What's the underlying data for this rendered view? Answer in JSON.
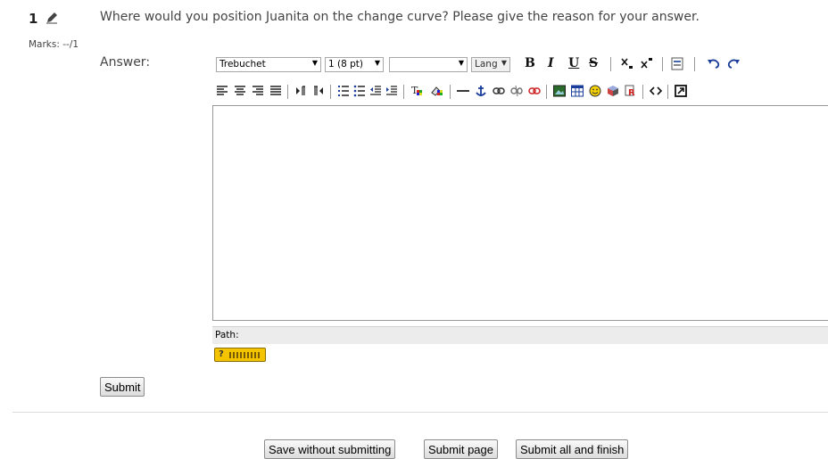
{
  "question": {
    "number": "1",
    "text": "Where would you position Juanita on the change curve? Please give the reason for your answer.",
    "marks": "Marks: --/1",
    "edit_icon": "pencil-icon"
  },
  "answer": {
    "label": "Answer:",
    "content": ""
  },
  "toolbar": {
    "font_family": "Trebuchet",
    "font_size": "1 (8 pt)",
    "format": "",
    "lang": "Lang",
    "bold": "B",
    "italic": "I",
    "underline": "U",
    "strike": "S",
    "row2_icons": [
      "align-left-icon",
      "align-center-icon",
      "align-right-icon",
      "justify-icon",
      "ltr-icon",
      "rtl-icon",
      "ordered-list-icon",
      "unordered-list-icon",
      "outdent-icon",
      "indent-icon",
      "text-color-icon",
      "background-color-icon",
      "horizontal-rule-icon",
      "anchor-icon",
      "link-icon",
      "unlink-icon",
      "nolink-icon",
      "insert-image-icon",
      "insert-table-icon",
      "smiley-icon",
      "special-char-icon",
      "search-replace-icon",
      "html-source-icon",
      "fullscreen-icon"
    ]
  },
  "editor": {
    "path_label": "Path:"
  },
  "buttons": {
    "submit": "Submit",
    "save_without_submitting": "Save without submitting",
    "submit_page": "Submit page",
    "submit_all": "Submit all and finish"
  }
}
